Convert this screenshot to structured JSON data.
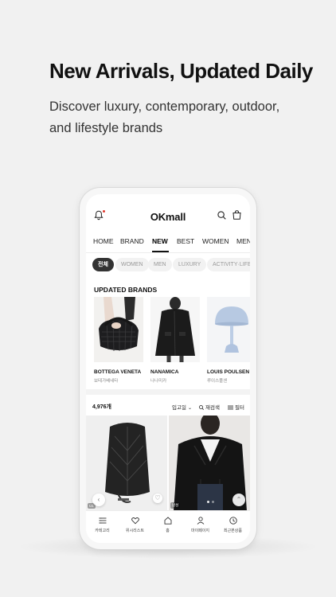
{
  "promo": {
    "headline": "New Arrivals, Updated Daily",
    "subtitle": "Discover luxury, contemporary, outdoor, and lifestyle brands"
  },
  "app": {
    "logo": "OKmall"
  },
  "nav": {
    "items": [
      "HOME",
      "BRAND",
      "NEW",
      "BEST",
      "WOMEN",
      "MEN"
    ],
    "active": "NEW"
  },
  "chips": {
    "items": [
      "전체",
      "WOMEN",
      "MEN",
      "LUXURY",
      "ACTIVITY·LIFE"
    ],
    "active": "전체"
  },
  "updated_brands": {
    "title": "UPDATED BRANDS",
    "brands": [
      {
        "name": "BOTTEGA VENETA",
        "korean": "보테가베네타"
      },
      {
        "name": "NANAMICA",
        "korean": "나나미카"
      },
      {
        "name": "LOUIS POULSEN",
        "korean": "루이스폴센"
      }
    ]
  },
  "product_list": {
    "count": "4,976개",
    "sort_label": "입고일",
    "research_label": "재검색",
    "filter_label": "필터",
    "products": [
      {
        "tag": "U1"
      },
      {
        "tag": "남성"
      }
    ]
  },
  "tabbar": {
    "items": [
      {
        "label": "카테고리",
        "icon": "menu-icon"
      },
      {
        "label": "위시리스트",
        "icon": "heart-icon"
      },
      {
        "label": "홈",
        "icon": "home-icon"
      },
      {
        "label": "마이페이지",
        "icon": "person-icon"
      },
      {
        "label": "최근본상품",
        "icon": "clock-icon"
      }
    ]
  },
  "colors": {
    "background": "#f1f1f1",
    "accent_dot": "#e03a2f",
    "active_chip": "#333333"
  }
}
